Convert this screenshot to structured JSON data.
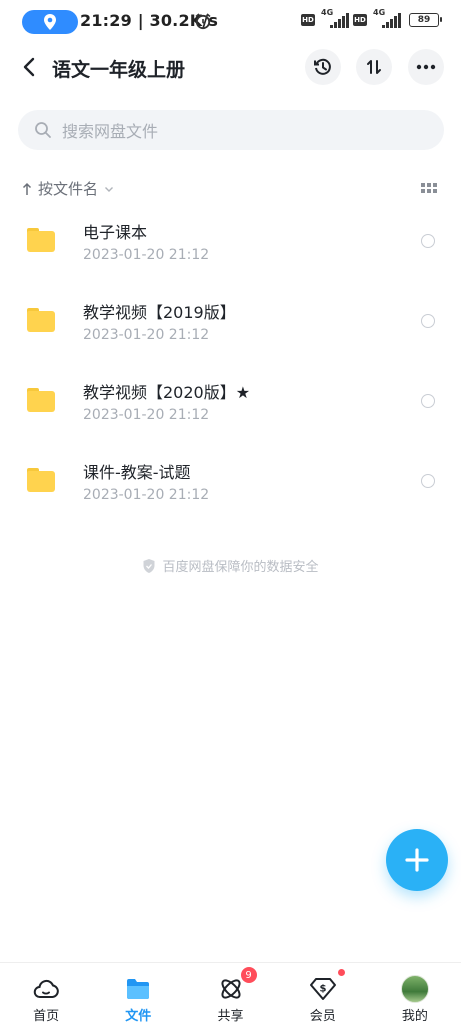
{
  "status_bar": {
    "time_speed": "21:29 | 30.2K/s",
    "network_1": "4G",
    "network_2": "4G",
    "hd_1": "HD",
    "hd_2": "HD",
    "battery": "89"
  },
  "header": {
    "title": "语文一年级上册",
    "icons": [
      "back-icon",
      "history-icon",
      "sort-icon",
      "more-icon"
    ]
  },
  "search": {
    "placeholder": "搜索网盘文件"
  },
  "sort": {
    "label": "按文件名"
  },
  "files": [
    {
      "name": "电子课本",
      "date": "2023-01-20   21:12"
    },
    {
      "name": "教学视频【2019版】",
      "date": "2023-01-20   21:12"
    },
    {
      "name": "教学视频【2020版】★",
      "date": "2023-01-20   21:12"
    },
    {
      "name": "课件-教案-试题",
      "date": "2023-01-20   21:12"
    }
  ],
  "safe_notice": "百度网盘保障你的数据安全",
  "tabbar": {
    "tabs": [
      {
        "label": "首页"
      },
      {
        "label": "文件"
      },
      {
        "label": "共享",
        "badge": "9"
      },
      {
        "label": "会员"
      },
      {
        "label": "我的"
      }
    ]
  },
  "colors": {
    "accent": "#2196f3",
    "fab": "#2ab1f6",
    "folder": "#ffd34e",
    "badge": "#ff4d5a"
  }
}
